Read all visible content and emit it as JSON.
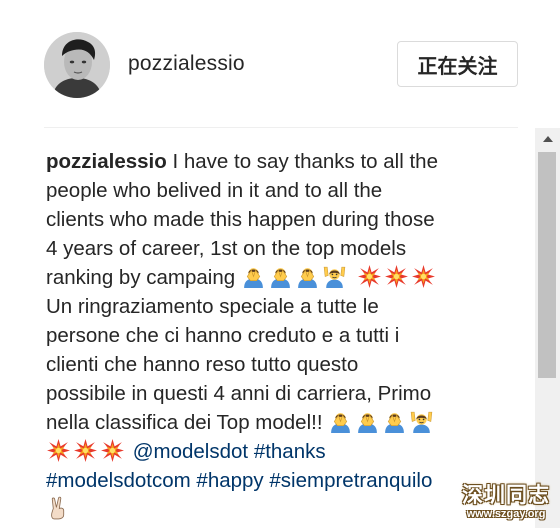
{
  "post": {
    "username": "pozzialessio",
    "follow_label": "正在关注"
  },
  "caption": {
    "username": "pozzialessio",
    "lines": [
      " I have to say thanks to all the",
      "people who belived in it and to all the",
      "clients who made this happen during those",
      "4 years of career, 1st on the top models",
      "ranking by campaing ",
      "Un ringraziamento speciale a tutte le",
      "persone che ci hanno creduto e a tutti i",
      "clienti che hanno reso tutto questo",
      "possibile in questi 4 anni di carriera, Primo",
      "nella classifica dei Top model!! "
    ],
    "mention": "@modelsdot",
    "hashtags": [
      "#thanks",
      "#modelsdotcom",
      "#happy",
      "#siempretranquilo"
    ],
    "emoji_sets": {
      "line5": [
        "praying-person-emoji",
        "praying-person-emoji",
        "praying-person-emoji",
        "raising-hands-person-emoji",
        "collision-emoji",
        "collision-emoji",
        "collision-emoji"
      ],
      "line10": [
        "praying-person-emoji",
        "praying-person-emoji",
        "praying-person-emoji",
        "raising-hands-person-emoji"
      ],
      "line11": [
        "collision-emoji",
        "collision-emoji",
        "collision-emoji"
      ],
      "line13": [
        "victory-hand-emoji"
      ]
    }
  },
  "watermark": {
    "title": "深圳同志",
    "url": "www.szgay.org"
  },
  "colors": {
    "text": "#262626",
    "link": "#003569",
    "border": "#dbdbdb"
  }
}
